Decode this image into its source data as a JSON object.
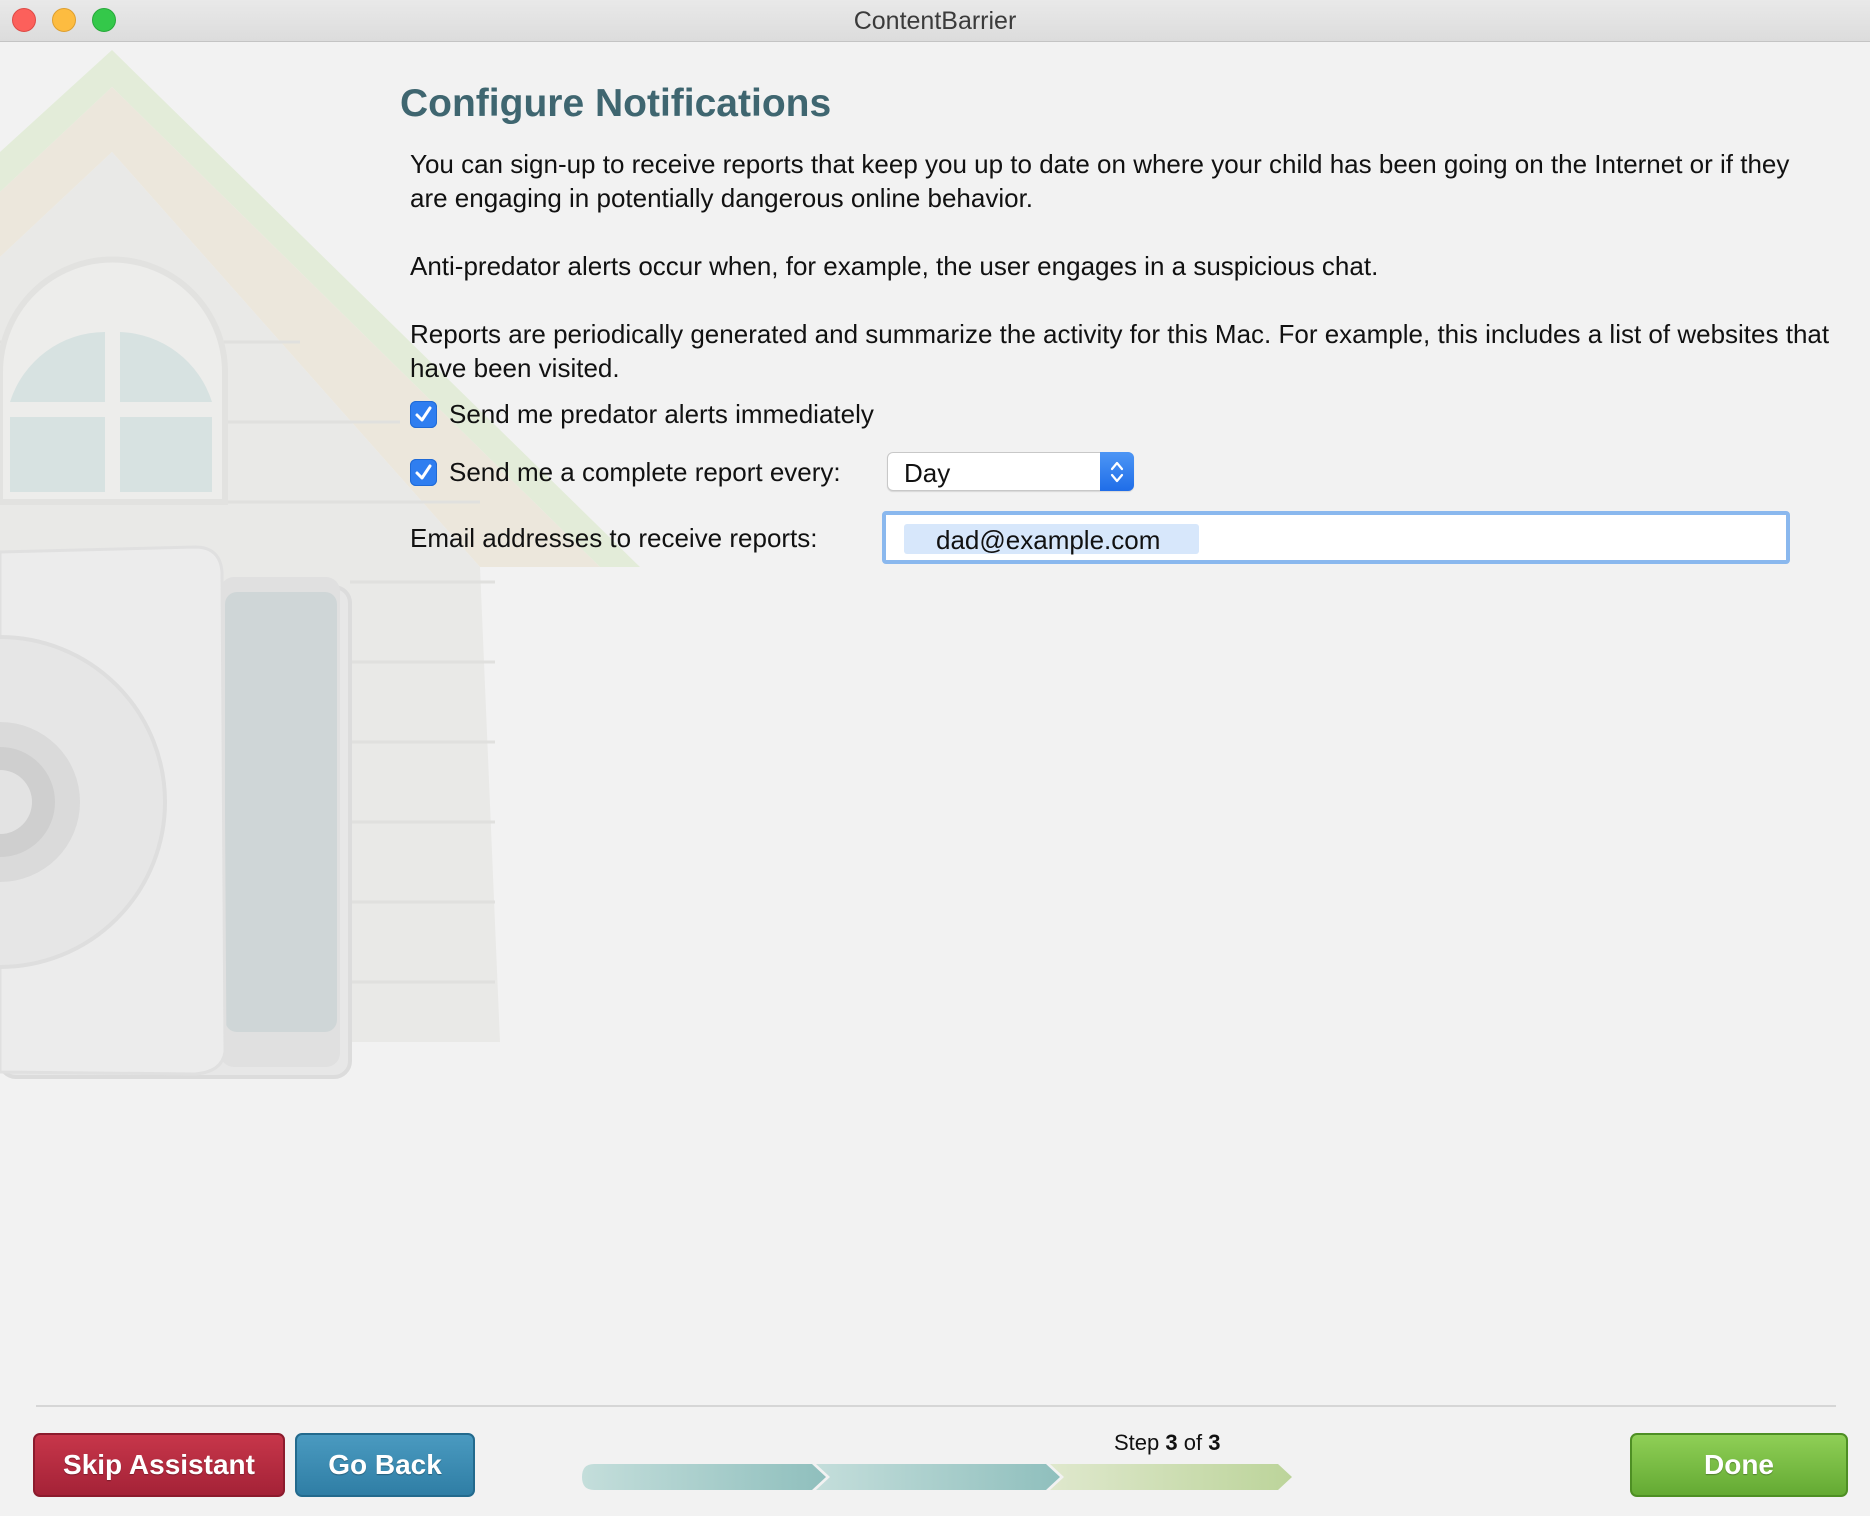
{
  "window": {
    "title": "ContentBarrier"
  },
  "page": {
    "heading": "Configure Notifications",
    "paragraphs": [
      "You can sign-up to receive reports that keep you up to date on where your child has been going on the Internet or if they are engaging in potentially dangerous online behavior.",
      "Anti-predator alerts occur when, for example, the user engages in a suspicious chat.",
      "Reports are periodically generated and summarize the activity for this Mac. For example, this includes a list of websites that have been visited."
    ]
  },
  "form": {
    "predator_alerts": {
      "label": "Send me predator alerts immediately",
      "checked": true
    },
    "complete_report": {
      "label": "Send me a complete report every:",
      "checked": true
    },
    "report_frequency": {
      "selected": "Day"
    },
    "email": {
      "label": "Email addresses to receive reports:",
      "tokens": [
        "dad@example.com"
      ]
    }
  },
  "footer": {
    "skip_label": "Skip Assistant",
    "back_label": "Go Back",
    "done_label": "Done",
    "step_prefix": "Step",
    "step_current": "3",
    "step_of": "of",
    "step_total": "3",
    "progress": {
      "completed_steps": 3,
      "total_steps": 3
    }
  },
  "colors": {
    "heading": "#3f6670",
    "checkbox": "#2f7ef0",
    "skip_button": "#b52b40",
    "back_button": "#3a8bb3",
    "done_button": "#76bd43"
  }
}
